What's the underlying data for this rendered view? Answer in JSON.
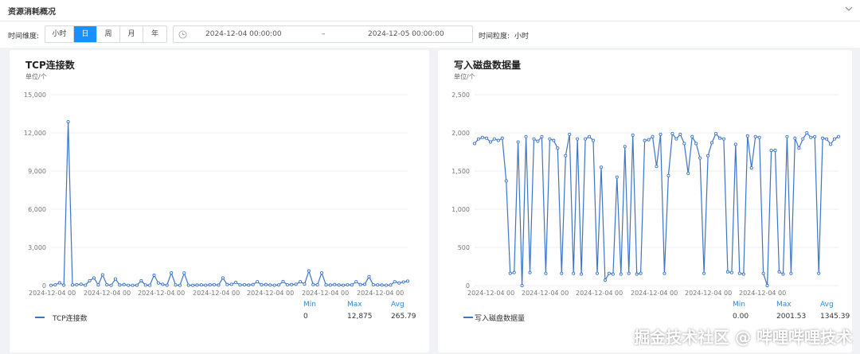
{
  "header": {
    "title": "资源消耗概况"
  },
  "toolbar": {
    "dimension_label": "时间维度:",
    "dimension_options": [
      "小时",
      "日",
      "周",
      "月",
      "年"
    ],
    "dimension_selected": "日",
    "start_time": "2024-12-04 00:00:00",
    "range_separator": "–",
    "end_time": "2024-12-05 00:00:00",
    "granularity_label": "时间粒度:",
    "granularity_value": "小时"
  },
  "colors": {
    "accent": "#1890ff",
    "series": "#3d74c8",
    "stat_header": "#2f86d6",
    "grid": "#ececec"
  },
  "stats_headers": {
    "min": "Min",
    "max": "Max",
    "avg": "Avg"
  },
  "charts": [
    {
      "title": "TCP连接数",
      "unit": "单位/个",
      "x_tick_label": "2024-12-04 00",
      "stats": {
        "min": "0",
        "max": "12,875",
        "avg": "265.79"
      },
      "legend": "TCP连接数"
    },
    {
      "title": "写入磁盘数据量",
      "unit": "单位/个",
      "x_tick_label": "2024-12-04 00",
      "stats": {
        "min": "0.00",
        "max": "2001.53",
        "avg": "1345.39"
      },
      "legend": "写入磁盘数据量"
    }
  ],
  "chart_data": [
    {
      "type": "line",
      "title": "TCP连接数",
      "ylabel": "单位/个",
      "ylim": [
        0,
        15000
      ],
      "yticks": [
        "0",
        "3,000",
        "6,000",
        "9,000",
        "12,000",
        "15,000"
      ],
      "xticks": [
        "2024-12-04 00",
        "2024-12-04 00",
        "2024-12-04 00",
        "2024-12-04 00",
        "2024-12-04 00",
        "2024-12-04 00",
        "2024-12-04 00"
      ],
      "grid": true,
      "legend_position": "bottom",
      "series": [
        {
          "name": "TCP连接数",
          "values": [
            20,
            60,
            220,
            30,
            12875,
            50,
            70,
            110,
            30,
            380,
            600,
            50,
            850,
            60,
            20,
            520,
            40,
            80,
            20,
            20,
            30,
            380,
            40,
            20,
            820,
            200,
            100,
            30,
            1000,
            50,
            20,
            980,
            30,
            20,
            40,
            50,
            30,
            60,
            70,
            40,
            600,
            80,
            100,
            250,
            50,
            60,
            40,
            80,
            300,
            60,
            80,
            40,
            30,
            50,
            320,
            60,
            80,
            100,
            300,
            120,
            1150,
            80,
            60,
            1000,
            50,
            40,
            80,
            40,
            30,
            60,
            50,
            300,
            80,
            100,
            700,
            60,
            50,
            40,
            30,
            40,
            300,
            200,
            280,
            350
          ]
        }
      ]
    },
    {
      "type": "line",
      "title": "写入磁盘数据量",
      "ylabel": "单位/个",
      "ylim": [
        0,
        2500
      ],
      "yticks": [
        "0",
        "500",
        "1,000",
        "1,500",
        "2,000",
        "2,500"
      ],
      "xticks": [
        "2024-12-04 00",
        "2024-12-04 00",
        "2024-12-04 00",
        "2024-12-04 00",
        "2024-12-04 00",
        "2024-12-04 00"
      ],
      "grid": true,
      "legend_position": "bottom",
      "series": [
        {
          "name": "写入磁盘数据量",
          "values": [
            1860,
            1920,
            1940,
            1930,
            1880,
            1920,
            1900,
            1930,
            1370,
            160,
            170,
            1880,
            0,
            1950,
            170,
            1920,
            1890,
            1950,
            160,
            1920,
            1900,
            1800,
            160,
            1700,
            1980,
            160,
            1920,
            150,
            1920,
            1950,
            1900,
            160,
            1550,
            70,
            160,
            150,
            1420,
            150,
            1820,
            160,
            1970,
            150,
            160,
            1900,
            1910,
            1950,
            1560,
            1980,
            160,
            1440,
            1990,
            1920,
            1980,
            1860,
            1470,
            1950,
            1860,
            1670,
            160,
            1700,
            1870,
            1990,
            1930,
            1920,
            180,
            170,
            1850,
            160,
            150,
            1960,
            1540,
            1950,
            1940,
            160,
            0,
            1770,
            1770,
            180,
            150,
            1950,
            160,
            1930,
            1800,
            1920,
            2000,
            1940,
            1950,
            160,
            1930,
            1920,
            1850,
            1920,
            1950
          ]
        }
      ]
    }
  ],
  "watermark": "掘金技术社区 @ 哔哩哔哩技术"
}
